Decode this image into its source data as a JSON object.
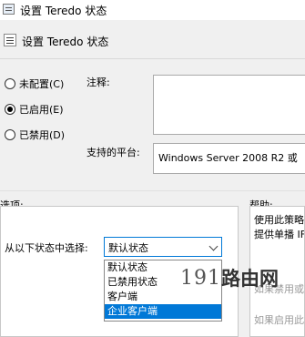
{
  "window": {
    "title": "设置 Teredo 状态"
  },
  "header": {
    "title": "设置 Teredo 状态"
  },
  "state": {
    "options": [
      {
        "label": "未配置(C)",
        "checked": false
      },
      {
        "label": "已启用(E)",
        "checked": true
      },
      {
        "label": "已禁用(D)",
        "checked": false
      }
    ]
  },
  "comment": {
    "label": "注释:",
    "value": ""
  },
  "platform": {
    "label": "支持的平台:",
    "value": "Windows Server 2008 R2 或"
  },
  "options_section": {
    "label": "选项:",
    "select_label": "从以下状态中选择:",
    "select_value": "默认状态",
    "dropdown_items": [
      "默认状态",
      "已禁用状态",
      "客户端",
      "企业客户端"
    ],
    "highlighted_index": 3
  },
  "help_section": {
    "label": "帮助:",
    "lines": [
      "使用此策略",
      "提供单播 IF",
      "如果禁用或",
      "如果启用此"
    ]
  },
  "watermark": {
    "number": "191",
    "text": "路由网"
  },
  "colors": {
    "accent": "#0078d7",
    "background": "#f0f0f0"
  }
}
